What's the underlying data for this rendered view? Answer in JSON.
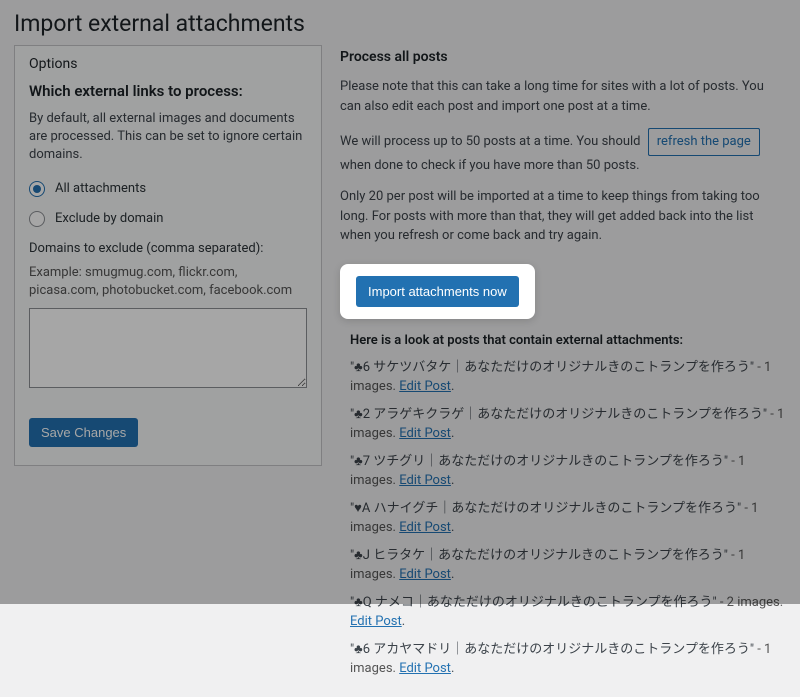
{
  "page_title": "Import external attachments",
  "options": {
    "box_title": "Options",
    "heading": "Which external links to process:",
    "description": "By default, all external images and documents are processed. This can be set to ignore certain domains.",
    "radio_all": "All attachments",
    "radio_exclude": "Exclude by domain",
    "domains_label": "Domains to exclude (comma separated):",
    "example": "Example: smugmug.com, flickr.com, picasa.com, photobucket.com, facebook.com",
    "save_label": "Save Changes"
  },
  "process": {
    "heading": "Process all posts",
    "note": "Please note that this can take a long time for sites with a lot of posts. You can also edit each post and import one post at a time.",
    "will_process_pre": "We will process up to 50 posts at a time. You should ",
    "refresh_label": "refresh the page",
    "will_process_post": " when done to check if you have more than 50 posts.",
    "per_post": "Only 20 per post will be imported at a time to keep things from taking too long. For posts with more than that, they will get added back into the list when you refresh or come back and try again.",
    "import_label": "Import attachments now",
    "posts_heading": "Here is a look at posts that contain external attachments:",
    "edit_label": "Edit Post"
  },
  "posts": [
    {
      "title": "\"♣6 サケツバタケ｜あなただけのオリジナルきのこトランプを作ろう\"",
      "meta": " - 1 images. "
    },
    {
      "title": "\"♣2 アラゲキクラゲ｜あなただけのオリジナルきのこトランプを作ろう\"",
      "meta": " - 1 images. "
    },
    {
      "title": "\"♣7 ツチグリ｜あなただけのオリジナルきのこトランプを作ろう\"",
      "meta": " - 1 images. "
    },
    {
      "title": "\"♥A ハナイグチ｜あなただけのオリジナルきのこトランプを作ろう\"",
      "meta": " - 1 images. "
    },
    {
      "title": "\"♣J ヒラタケ｜あなただけのオリジナルきのこトランプを作ろう\"",
      "meta": " - 1 images. "
    },
    {
      "title": "\"♣Q ナメコ｜あなただけのオリジナルきのこトランプを作ろう\"",
      "meta": " - 2 images. "
    },
    {
      "title": "\"♣6 アカヤマドリ｜あなただけのオリジナルきのこトランプを作ろう\"",
      "meta": " - 1 images. "
    }
  ]
}
